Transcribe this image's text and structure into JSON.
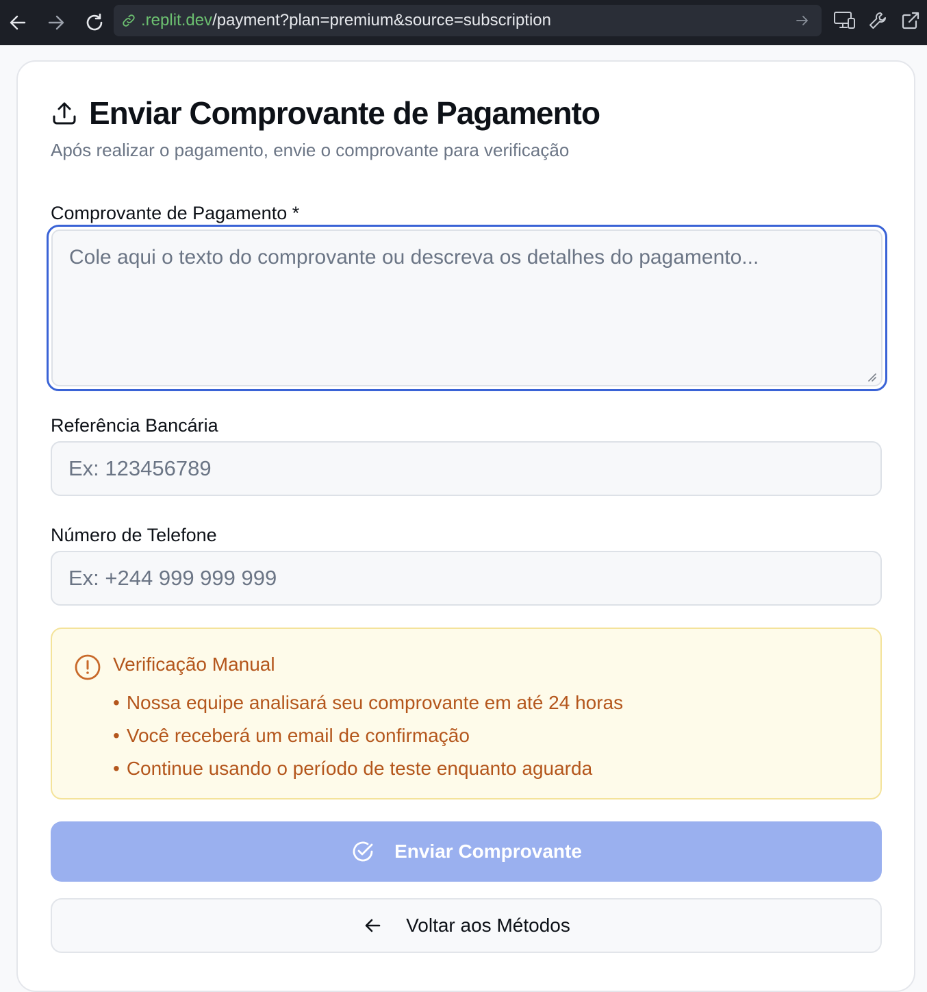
{
  "browser": {
    "url_domain": ".replit.dev",
    "url_path": "/payment?plan=premium&source=subscription"
  },
  "page": {
    "title": "Enviar Comprovante de Pagamento",
    "subtitle": "Após realizar o pagamento, envie o comprovante para verificação"
  },
  "form": {
    "proof_label": "Comprovante de Pagamento *",
    "proof_placeholder": "Cole aqui o texto do comprovante ou descreva os detalhes do pagamento...",
    "proof_value": "",
    "bank_ref_label": "Referência Bancária",
    "bank_ref_placeholder": "Ex: 123456789",
    "bank_ref_value": "",
    "phone_label": "Número de Telefone",
    "phone_placeholder": "Ex: +244 999 999 999",
    "phone_value": ""
  },
  "notice": {
    "title": "Verificação Manual",
    "items": [
      "Nossa equipe analisará seu comprovante em até 24 horas",
      "Você receberá um email de confirmação",
      "Continue usando o período de teste enquanto aguarda"
    ]
  },
  "buttons": {
    "submit_label": "Enviar Comprovante",
    "back_label": "Voltar aos Métodos"
  },
  "colors": {
    "accent": "#3a63d6",
    "submit_disabled": "#9ab0ef",
    "warning_text": "#b4561c",
    "warning_bg": "#fefbea"
  }
}
